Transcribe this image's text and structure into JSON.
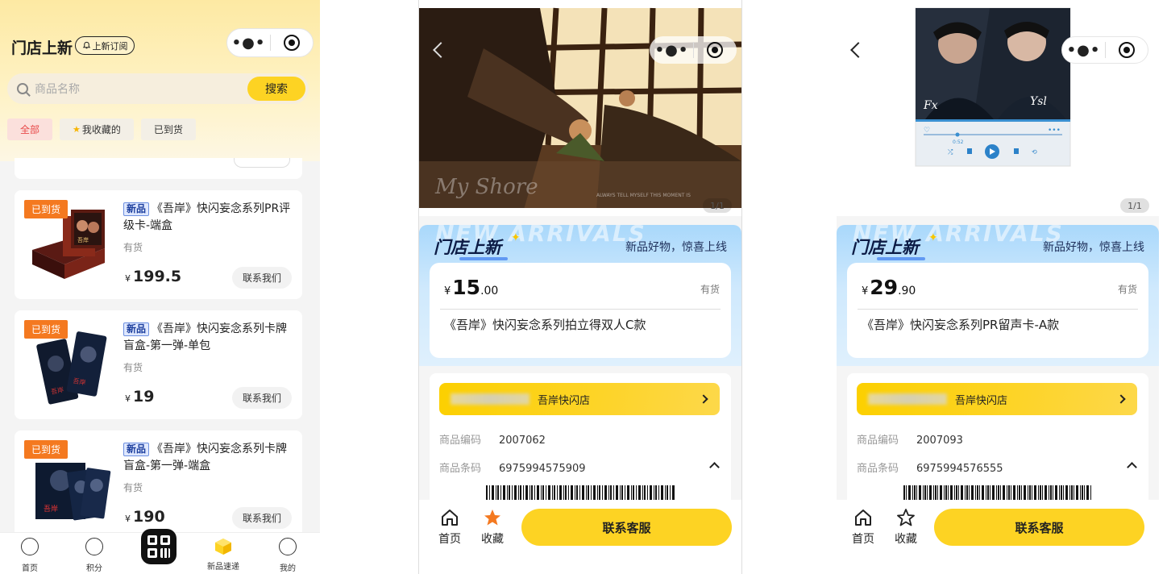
{
  "panel1": {
    "title": "门店上新",
    "subscribe_label": "上新订阅",
    "search_placeholder": "商品名称",
    "search_button": "搜索",
    "filters": [
      "全部",
      "我收藏的",
      "已到货"
    ],
    "products": [
      {
        "badge": "已到货",
        "tag": "新品",
        "name": "《吾岸》快闪妄念系列PR评级卡-端盒",
        "stock": "有货",
        "currency": "¥",
        "price": "199.5",
        "contact": "联系我们"
      },
      {
        "badge": "已到货",
        "tag": "新品",
        "name": "《吾岸》快闪妄念系列卡牌盲盒-第一弹-单包",
        "stock": "有货",
        "currency": "¥",
        "price": "19",
        "contact": "联系我们"
      },
      {
        "badge": "已到货",
        "tag": "新品",
        "name": "《吾岸》快闪妄念系列卡牌盲盒-第一弹-端盒",
        "stock": "有货",
        "currency": "¥",
        "price": "190",
        "contact": "联系我们"
      }
    ],
    "tabs": [
      "首页",
      "积分",
      "新品速递",
      "我的"
    ]
  },
  "panel2": {
    "image_counter": "1/1",
    "banner_title": "门店上新",
    "banner_ghost": "NEW ARRIVALS",
    "banner_slogan": "新品好物，惊喜上线",
    "currency": "¥",
    "price_int": "15",
    "price_dec": ".00",
    "stock": "有货",
    "name": "《吾岸》快闪妄念系列拍立得双人C款",
    "store_name": "吾岸快闪店",
    "code_label": "商品编码",
    "code_value": "2007062",
    "barcode_label": "商品条码",
    "barcode_value": "6975994575909",
    "home_label": "首页",
    "fav_label": "收藏",
    "service_button": "联系客服"
  },
  "panel3": {
    "image_counter": "1/1",
    "banner_title": "门店上新",
    "banner_ghost": "NEW ARRIVALS",
    "banner_slogan": "新品好物，惊喜上线",
    "currency": "¥",
    "price_int": "29",
    "price_dec": ".90",
    "stock": "有货",
    "name": "《吾岸》快闪妄念系列PR留声卡-A款",
    "store_name": "吾岸快闪店",
    "code_label": "商品编码",
    "code_value": "2007093",
    "barcode_label": "商品条码",
    "barcode_value": "6975994576555",
    "home_label": "首页",
    "fav_label": "收藏",
    "service_button": "联系客服",
    "player_time": "0:52"
  },
  "colors": {
    "accent_yellow": "#fdd323",
    "badge_orange": "#f47920",
    "active_filter_red": "#e84a4a",
    "banner_blue": "#a9d8fb"
  }
}
